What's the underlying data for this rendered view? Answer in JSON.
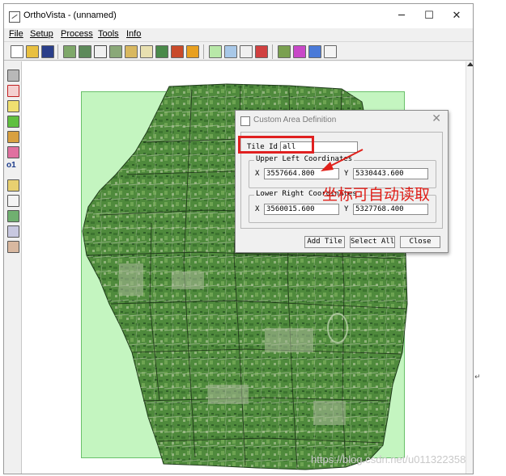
{
  "window": {
    "title": "OrthoVista - (unnamed)",
    "minimize_icon": "minimize-icon",
    "maximize_icon": "maximize-icon",
    "close_icon": "close-icon",
    "minimize_glyph": "─",
    "maximize_glyph": "☐",
    "close_glyph": "✕"
  },
  "menu": {
    "items": [
      "File",
      "Setup",
      "Process",
      "Tools",
      "Info"
    ]
  },
  "toolbar": {
    "icons": [
      "new-file-icon",
      "open-folder-icon",
      "save-icon",
      "add-image-icon",
      "add-images-icon",
      "crosshair-icon",
      "image-edit-icon",
      "rotate-icon",
      "list-edit-icon",
      "import-icon",
      "export-icon",
      "folder-icon",
      "grid-green-icon",
      "grid-blue-icon",
      "link-icon",
      "red-cross-icon",
      "tools-icon",
      "pencil-icon",
      "palette-icon",
      "info-window-icon"
    ]
  },
  "left_toolbar": {
    "icons": [
      "overview-icon",
      "select-red-icon",
      "frame-icon",
      "green-square-icon",
      "tiles-icon",
      "shape-icon",
      "zoom-100-icon",
      "tile-add-icon",
      "hand-pan-icon",
      "zoom-in-icon",
      "zoom-icon",
      "home-icon"
    ],
    "zoom_label": "o1"
  },
  "dialog": {
    "title": "Custom Area Definition",
    "close_glyph": "✕",
    "tile_id_label": "Tile Id",
    "tile_id_value": "all",
    "upper_left": {
      "title": "Upper Left Coordinates",
      "x_label": "X",
      "x_value": "3557664.800",
      "y_label": "Y",
      "y_value": "5330443.600"
    },
    "lower_right": {
      "title": "Lower Right Coordinates",
      "x_label": "X",
      "x_value": "3560015.600",
      "y_label": "Y",
      "y_value": "5327768.400"
    },
    "buttons": {
      "add_tile": "Add Tile",
      "select_all": "Select All",
      "close": "Close"
    }
  },
  "annotation": {
    "text": "坐标可自动读取",
    "color": "#e0201a"
  },
  "watermark": "https://blog.csdn.net/u011322358",
  "colors": {
    "coverage_green": "#c4f5c0",
    "highlight_red": "#e02020"
  }
}
